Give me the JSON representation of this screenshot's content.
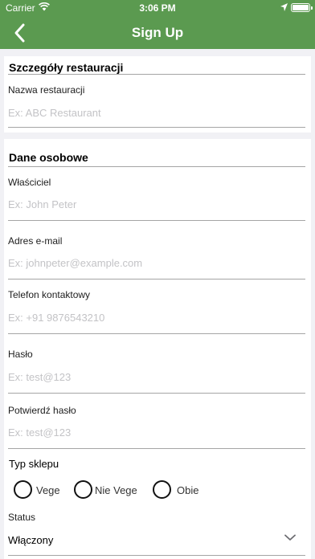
{
  "status_bar": {
    "carrier": "Carrier",
    "time": "3:06 PM"
  },
  "nav": {
    "title": "Sign Up"
  },
  "restaurant": {
    "section_title": "Szczegóły restauracji",
    "name_label": "Nazwa restauracji",
    "name_placeholder": "Ex: ABC Restaurant"
  },
  "personal": {
    "section_title": "Dane osobowe",
    "owner_label": "Właściciel",
    "owner_placeholder": "Ex: John Peter",
    "email_label": "Adres e-mail",
    "email_placeholder": "Ex: johnpeter@example.com",
    "phone_label": "Telefon kontaktowy",
    "phone_placeholder": "Ex: +91 9876543210",
    "password_label": "Hasło",
    "password_placeholder": "Ex: test@123",
    "confirm_label": "Potwierdź hasło",
    "confirm_placeholder": "Ex: test@123",
    "shop_type_label": "Typ sklepu",
    "shop_type_options": [
      "Vege",
      "Nie Vege",
      "Obie"
    ],
    "status_label": "Status",
    "status_value": "Włączony"
  },
  "colors": {
    "header": "#5b9a50",
    "background": "#f1f1f5"
  },
  "icons": {
    "back": "chevron-left-icon",
    "dropdown": "chevron-down-icon"
  }
}
